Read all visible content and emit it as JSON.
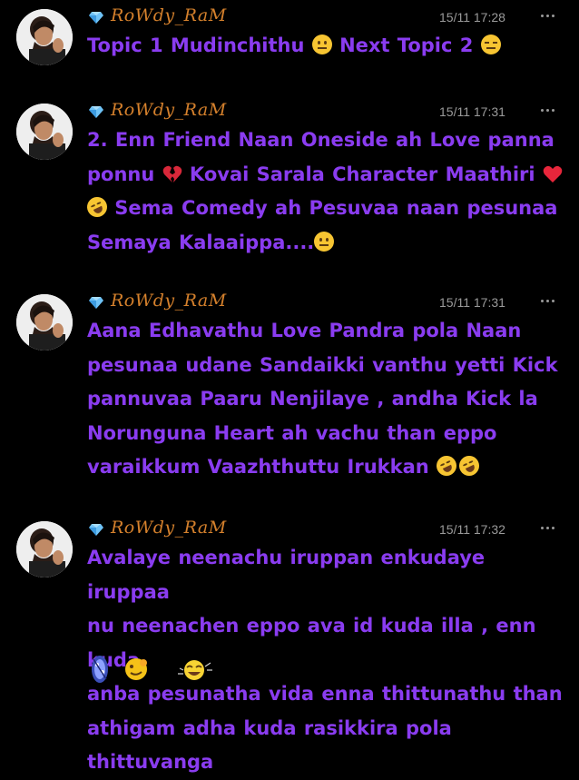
{
  "colors": {
    "background": "#000000",
    "message_text": "#8a3cf0",
    "username": "#d4802c",
    "timestamp": "#9a9a9a"
  },
  "messages": [
    {
      "username": "RoWdy_RaM",
      "timestamp": "15/11 17:28",
      "lines": [
        [
          "Topic 1 Mudinchithu ",
          "neutral-face",
          " Next Topic 2 ",
          "expressionless"
        ]
      ]
    },
    {
      "username": "RoWdy_RaM",
      "timestamp": "15/11 17:31",
      "lines": [
        [
          "2. Enn Friend Naan Oneside ah Love panna"
        ],
        [
          "ponnu ",
          "broken-heart",
          " Kovai Sarala Character Maathiri ",
          "red-heart"
        ],
        [
          "rofl",
          " Sema Comedy ah Pesuvaa naan pesunaa"
        ],
        [
          "Semaya Kalaaippa....",
          "neutral-face"
        ]
      ]
    },
    {
      "username": "RoWdy_RaM",
      "timestamp": "15/11 17:31",
      "lines": [
        [
          "Aana Edhavathu Love Pandra pola Naan"
        ],
        [
          "pesunaa udane Sandaikki vanthu yetti Kick"
        ],
        [
          "pannuvaa Paaru Nenjilaye , andha Kick la"
        ],
        [
          "Norunguna Heart ah vachu than eppo"
        ],
        [
          "varaikkum Vaazhthuttu Irukkan ",
          "rofl",
          "rofl"
        ]
      ]
    },
    {
      "username": "RoWdy_RaM",
      "timestamp": "15/11 17:32",
      "lines": [
        [
          "Avalaye neenachu iruppan enkudaye iruppaa"
        ],
        [
          "nu neenachen eppo ava id kuda illa , enn kuda"
        ],
        [
          "anba pesunatha vida enna thittunathu than"
        ],
        [
          "athigam adha kuda rasikkira pola thittuvanga"
        ]
      ],
      "stickers": [
        "sticker-blue-figure",
        "sticker-yellow-face",
        "sticker-laughing-face"
      ]
    }
  ]
}
